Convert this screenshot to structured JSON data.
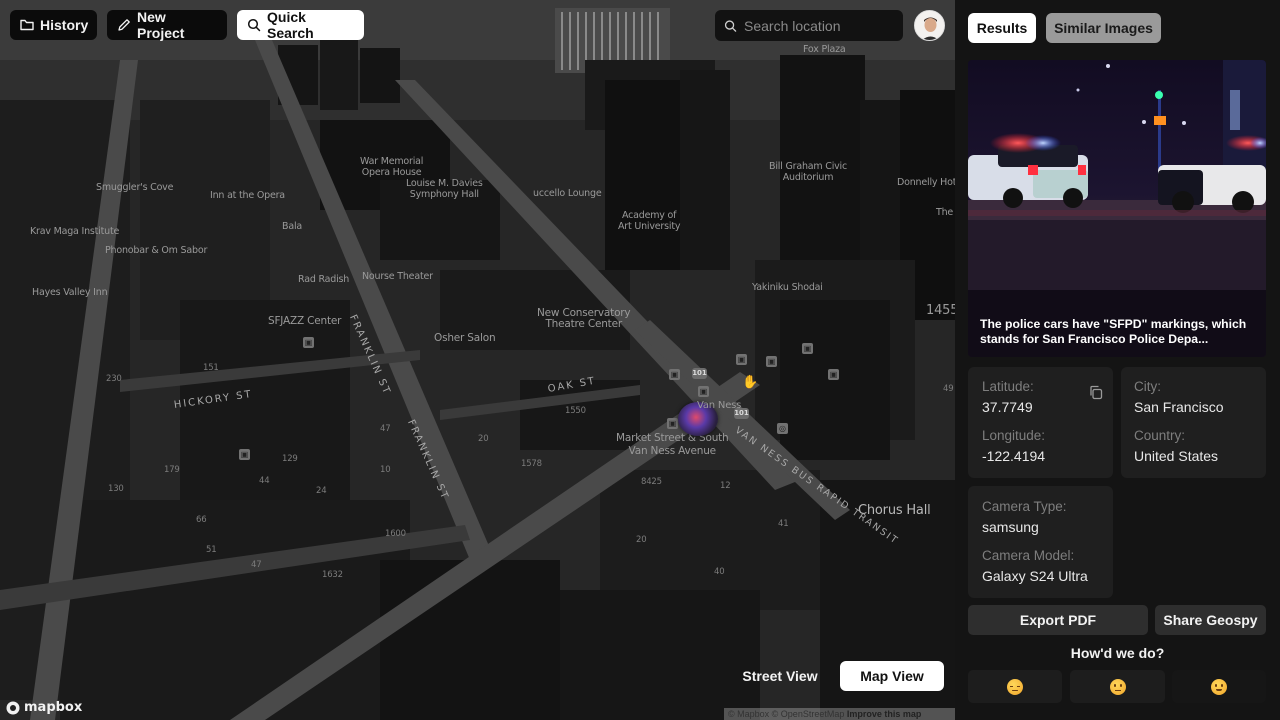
{
  "toolbar": {
    "history_label": "History",
    "new_project_label": "New Project",
    "quick_search_label": "Quick Search"
  },
  "location_search": {
    "placeholder": "Search location",
    "value": ""
  },
  "map": {
    "labels": {
      "fox_plaza": "Fox Plaza",
      "war_memorial": "War Memorial\nOpera House",
      "louise_davies": "Louise M. Davies\nSymphony Hall",
      "uccello": "uccello Lounge",
      "smugglers": "Smuggler's Cove",
      "inn_opera": "Inn at the Opera",
      "krav_maga": "Krav Maga Institute",
      "bala": "Bala",
      "phonobar": "Phonobar & Om Sabor",
      "rad_radish": "Rad Radish",
      "nourse": "Nourse Theater",
      "hayes_valley_inn": "Hayes Valley Inn",
      "sfjazz": "SFJAZZ Center",
      "osher": "Osher Salon",
      "new_conservatory": "New Conservatory\nTheatre Center",
      "academy": "Academy of\nArt University",
      "bill_graham": "Bill Graham Civic\nAuditorium",
      "donnelly": "Donnelly Hotel",
      "the": "The",
      "yakiniku": "Yakiniku Shodai",
      "market_van_ness": "Market Street & South\nVan Ness Avenue",
      "chorus_hall": "Chorus Hall",
      "van_ness_short": "Van Ness"
    },
    "streets": {
      "franklin_1": "FRANKLIN ST",
      "franklin_2": "FRANKLIN ST",
      "hickory": "HICKORY ST",
      "oak": "OAK ST",
      "van_ness_brt": "VAN NESS BUS RAPID TRANSIT"
    },
    "highway_shield": "101",
    "address_numbers": [
      "1455",
      "230",
      "151",
      "47",
      "129",
      "179",
      "44",
      "10",
      "24",
      "130",
      "66",
      "51",
      "1600",
      "47",
      "1632",
      "20",
      "1550",
      "1578",
      "8425",
      "12",
      "41",
      "20",
      "40",
      "49"
    ],
    "view_toggle": {
      "street_view_label": "Street View",
      "map_view_label": "Map View",
      "active": "Map View"
    },
    "attribution": {
      "mapbox": "© Mapbox",
      "osm": "© OpenStreetMap",
      "improve": "Improve this map"
    },
    "logo_text": "mapbox"
  },
  "panel": {
    "tabs": [
      {
        "label": "Results",
        "active": true
      },
      {
        "label": "Similar Images",
        "active": false
      }
    ],
    "image_caption": "The police cars have \"SFPD\" markings, which stands for San Francisco Police Depa...",
    "location": {
      "latitude_label": "Latitude:",
      "latitude": "37.7749",
      "longitude_label": "Longitude:",
      "longitude": "-122.4194",
      "city_label": "City:",
      "city": "San Francisco",
      "country_label": "Country:",
      "country": "United States"
    },
    "camera": {
      "type_label": "Camera Type:",
      "type": "samsung",
      "model_label": "Camera Model:",
      "model": "Galaxy S24 Ultra"
    },
    "actions": {
      "export_pdf": "Export PDF",
      "share": "Share Geospy"
    },
    "feedback": {
      "title": "How'd we do?",
      "options": [
        "sad-face",
        "neutral-face",
        "slight-smile-face"
      ]
    }
  }
}
